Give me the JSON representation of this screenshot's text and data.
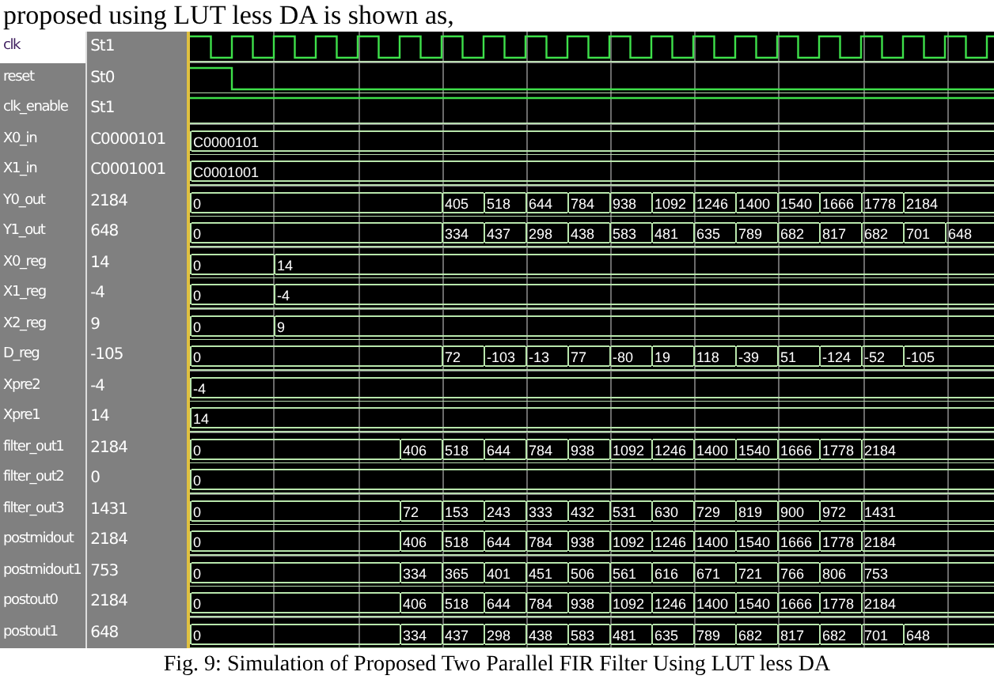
{
  "intro_text": "proposed using LUT less DA is shown as,",
  "signals": [
    {
      "name": "clk",
      "value": "St1",
      "selected": true,
      "kind": "clock"
    },
    {
      "name": "reset",
      "value": "St0",
      "selected": false,
      "kind": "pulse"
    },
    {
      "name": "clk_enable",
      "value": "St1",
      "selected": false,
      "kind": "high"
    },
    {
      "name": "X0_in",
      "value": "C0000101",
      "selected": false,
      "kind": "constant",
      "segments": [
        "C0000101"
      ]
    },
    {
      "name": "X1_in",
      "value": "C0001001",
      "selected": false,
      "kind": "constant",
      "segments": [
        "C0001001"
      ]
    },
    {
      "name": "Y0_out",
      "value": "2184",
      "selected": false,
      "kind": "output",
      "segments": [
        "0",
        "405",
        "518",
        "644",
        "784",
        "938",
        "1092",
        "1246",
        "1400",
        "1540",
        "1666",
        "1778",
        "2184"
      ]
    },
    {
      "name": "Y1_out",
      "value": "648",
      "selected": false,
      "kind": "output",
      "segments": [
        "0",
        "334",
        "437",
        "298",
        "438",
        "583",
        "481",
        "635",
        "789",
        "682",
        "817",
        "682",
        "701",
        "648"
      ]
    },
    {
      "name": "X0_reg",
      "value": "14",
      "selected": false,
      "kind": "register",
      "segments": [
        "0",
        "14"
      ]
    },
    {
      "name": "X1_reg",
      "value": "-4",
      "selected": false,
      "kind": "register",
      "segments": [
        "0",
        "-4"
      ]
    },
    {
      "name": "X2_reg",
      "value": "9",
      "selected": false,
      "kind": "register",
      "segments": [
        "0",
        "9"
      ]
    },
    {
      "name": "D_reg",
      "value": "-105",
      "selected": false,
      "kind": "output",
      "segments": [
        "0",
        "72",
        "-103",
        "-13",
        "77",
        "-80",
        "19",
        "118",
        "-39",
        "51",
        "-124",
        "-52",
        "-105"
      ]
    },
    {
      "name": "Xpre2",
      "value": "-4",
      "selected": false,
      "kind": "constant",
      "segments": [
        "-4"
      ]
    },
    {
      "name": "Xpre1",
      "value": "14",
      "selected": false,
      "kind": "constant",
      "segments": [
        "14"
      ]
    },
    {
      "name": "filter_out1",
      "value": "2184",
      "selected": false,
      "kind": "filter",
      "segments": [
        "0",
        "406",
        "518",
        "644",
        "784",
        "938",
        "1092",
        "1246",
        "1400",
        "1540",
        "1666",
        "1778",
        "2184"
      ]
    },
    {
      "name": "filter_out2",
      "value": "0",
      "selected": false,
      "kind": "constant",
      "segments": [
        "0"
      ]
    },
    {
      "name": "filter_out3",
      "value": "1431",
      "selected": false,
      "kind": "filter",
      "segments": [
        "0",
        "72",
        "153",
        "243",
        "333",
        "432",
        "531",
        "630",
        "729",
        "819",
        "900",
        "972",
        "1431"
      ]
    },
    {
      "name": "postmidout",
      "value": "2184",
      "selected": false,
      "kind": "filter",
      "segments": [
        "0",
        "406",
        "518",
        "644",
        "784",
        "938",
        "1092",
        "1246",
        "1400",
        "1540",
        "1666",
        "1778",
        "2184"
      ]
    },
    {
      "name": "postmidout1",
      "value": "753",
      "selected": false,
      "kind": "filter",
      "segments": [
        "0",
        "334",
        "365",
        "401",
        "451",
        "506",
        "561",
        "616",
        "671",
        "721",
        "766",
        "806",
        "753"
      ]
    },
    {
      "name": "postout0",
      "value": "2184",
      "selected": false,
      "kind": "filter",
      "segments": [
        "0",
        "406",
        "518",
        "644",
        "784",
        "938",
        "1092",
        "1246",
        "1400",
        "1540",
        "1666",
        "1778",
        "2184"
      ]
    },
    {
      "name": "postout1",
      "value": "648",
      "selected": false,
      "kind": "filter",
      "segments": [
        "0",
        "334",
        "437",
        "298",
        "438",
        "583",
        "481",
        "635",
        "789",
        "682",
        "817",
        "682",
        "701",
        "648"
      ]
    }
  ],
  "caption": "Fig. 9: Simulation of Proposed Two Parallel FIR Filter Using LUT less DA"
}
